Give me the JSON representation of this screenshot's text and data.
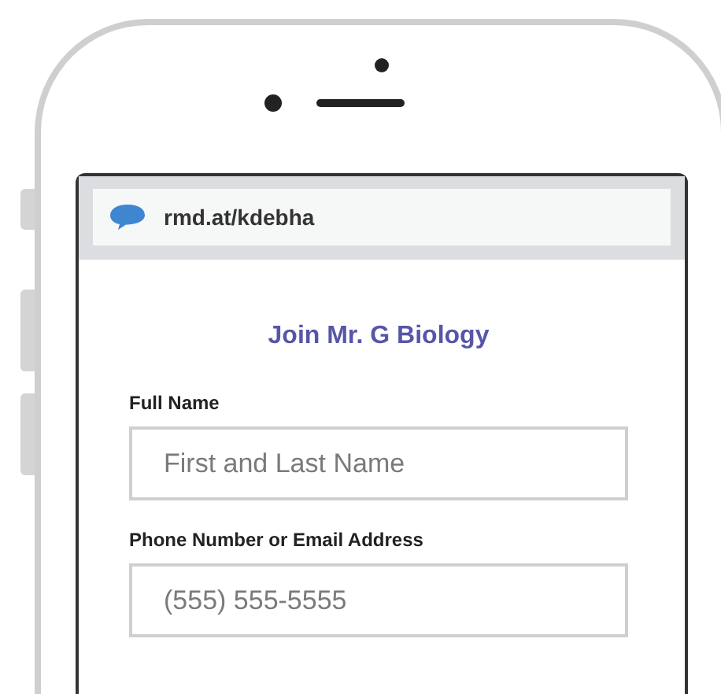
{
  "address_bar": {
    "url": "rmd.at/kdebha"
  },
  "form": {
    "title": "Join Mr. G Biology",
    "fields": [
      {
        "label": "Full Name",
        "placeholder": "First and Last Name"
      },
      {
        "label": "Phone Number or Email Address",
        "placeholder": "(555) 555-5555"
      }
    ]
  }
}
